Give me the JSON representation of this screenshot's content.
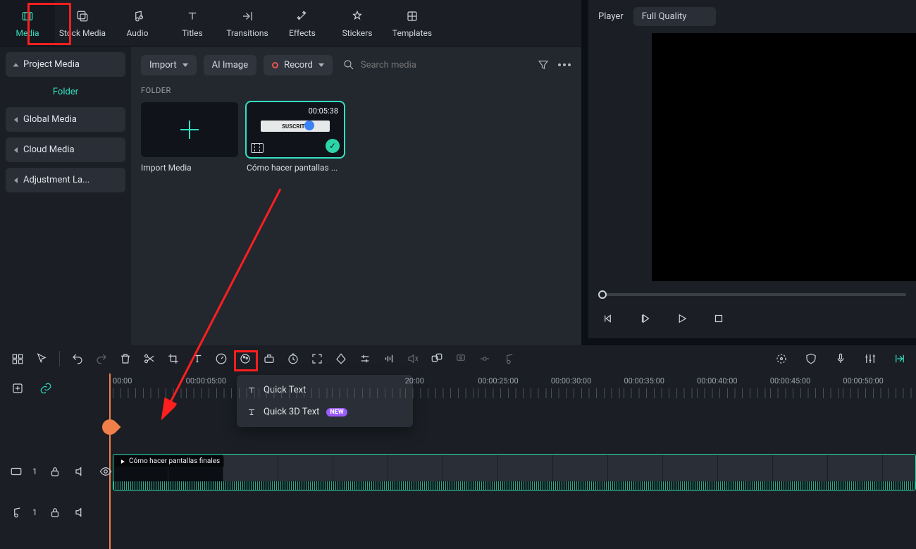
{
  "top_tabs": {
    "media": "Media",
    "stock": "Stock Media",
    "audio": "Audio",
    "titles": "Titles",
    "transitions": "Transitions",
    "effects": "Effects",
    "stickers": "Stickers",
    "templates": "Templates"
  },
  "sidebar": {
    "project_media": "Project Media",
    "folder": "Folder",
    "global_media": "Global Media",
    "cloud_media": "Cloud Media",
    "adjustment_layer": "Adjustment La..."
  },
  "browser": {
    "import": "Import",
    "ai_image": "AI Image",
    "record": "Record",
    "search_placeholder": "Search media",
    "section": "FOLDER",
    "thumb_import": "Import Media",
    "thumb_clip": "Cómo hacer pantallas ...",
    "clip_duration": "00:05:38",
    "clip_badge": "SUSCRITO"
  },
  "player": {
    "label": "Player",
    "quality": "Full Quality"
  },
  "timeline": {
    "text_popup": {
      "quick_text": "Quick Text",
      "quick_3d": "Quick 3D Text",
      "new": "NEW"
    },
    "ticks": [
      "00:00",
      "00:00:05:00",
      "",
      "",
      "20:00",
      "00:00:25:00",
      "00:00:30:00",
      "00:00:35:00",
      "00:00:40:00",
      "00:00:45:00",
      "00:00:50:00"
    ],
    "clip_title": "Cómo hacer pantallas finales",
    "video_track_index": "1",
    "audio_track_index": "1"
  }
}
